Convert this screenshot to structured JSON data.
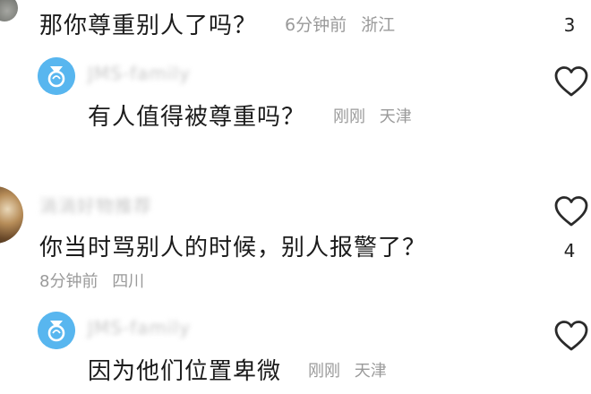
{
  "comments": [
    {
      "text": "那你尊重别人了吗？",
      "time": "6分钟前",
      "location": "浙江",
      "like_count": "3"
    },
    {
      "username": "JMS-family",
      "text": "有人值得被尊重吗？",
      "time": "刚刚",
      "location": "天津"
    },
    {
      "username": "淌淌好物推荐",
      "text": "你当时骂别人的时候，别人报警了？",
      "time": "8分钟前",
      "location": "四川",
      "like_count": "4"
    },
    {
      "username": "JMS-family",
      "text": "因为他们位置卑微",
      "time": "刚刚",
      "location": "天津"
    }
  ],
  "colors": {
    "avatar_blue": "#58b6ef",
    "meta_gray": "#9a9a9a",
    "text": "#1b1b1b"
  },
  "icons": {
    "like": "heart-outline-icon",
    "avatar_badge": "ring-badge-icon"
  }
}
